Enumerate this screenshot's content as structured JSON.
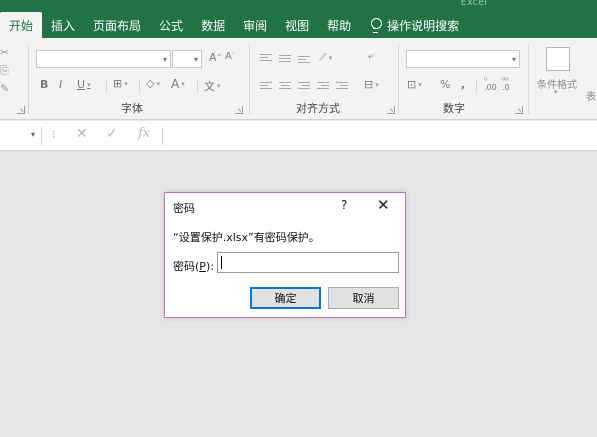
{
  "app": {
    "title": "Excel"
  },
  "tabs": [
    {
      "label": "开始",
      "active": true
    },
    {
      "label": "插入"
    },
    {
      "label": "页面布局"
    },
    {
      "label": "公式"
    },
    {
      "label": "数据"
    },
    {
      "label": "审阅"
    },
    {
      "label": "视图"
    },
    {
      "label": "帮助"
    }
  ],
  "tell_me": {
    "label": "操作说明搜索",
    "icon": "lightbulb-icon"
  },
  "ribbon": {
    "font_group": {
      "label": "字体",
      "grow": "A",
      "shrink": "A",
      "bold": "B",
      "italic": "I",
      "underline": "U",
      "font_color": "A",
      "phonetic": "文"
    },
    "alignment_group": {
      "label": "对齐方式"
    },
    "number_group": {
      "label": "数字",
      "percent": "%",
      "comma": ","
    },
    "styles_group": {
      "conditional_format_label": "条件格式",
      "format_table_partial": "表"
    }
  },
  "formula_bar": {
    "cancel": "✕",
    "enter": "✓",
    "function": "fx"
  },
  "dialog": {
    "title": "密码",
    "help": "?",
    "close": "✕",
    "message": "“设置保护.xlsx”有密码保护。",
    "password_label": "密码(",
    "password_accel": "P",
    "password_label_end": "):",
    "password_value": "",
    "ok_label": "确定",
    "cancel_label": "取消"
  },
  "colors": {
    "ribbon_tab_bg": "#217346",
    "ribbon_bg": "#f3f3f3",
    "workspace_bg": "#e6e6e6",
    "dialog_border": "#c870c8",
    "default_button_border": "#0078d7"
  }
}
